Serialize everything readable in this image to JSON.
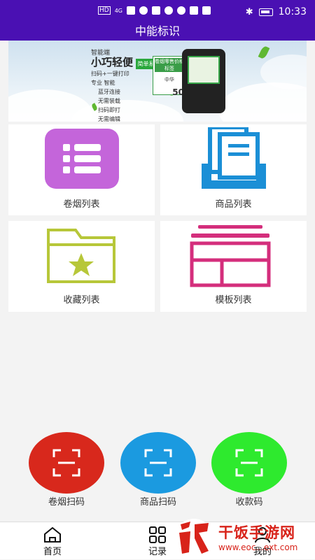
{
  "status_bar": {
    "time": "10:33",
    "network": "4G",
    "hd": "HD"
  },
  "app": {
    "title": "中能标识"
  },
  "banner": {
    "brand": "智能端",
    "slogan": "小巧轻便",
    "tag": "简单易用",
    "features": [
      "扫码+一键打印",
      "专业 智能",
      "蓝牙连接",
      "无需装载",
      "扫码即打",
      "无需编辑"
    ],
    "card_title": "卷烟零售价格标签",
    "card_name": "中华",
    "card_price": "50"
  },
  "tiles": [
    {
      "label": "卷烟列表",
      "icon": "list-icon",
      "color": "#c465da"
    },
    {
      "label": "商品列表",
      "icon": "document-tray-icon",
      "color": "#1b8fd6"
    },
    {
      "label": "收藏列表",
      "icon": "folder-star-icon",
      "color": "#b7c739"
    },
    {
      "label": "模板列表",
      "icon": "template-layout-icon",
      "color": "#d42e7c"
    }
  ],
  "scan_buttons": [
    {
      "label": "卷烟扫码",
      "color": "#d8281c"
    },
    {
      "label": "商品扫码",
      "color": "#1b9ae0"
    },
    {
      "label": "收款码",
      "color": "#2eea2e"
    }
  ],
  "tabbar": {
    "items": [
      {
        "label": "首页",
        "icon": "home-icon"
      },
      {
        "label": "记录",
        "icon": "grid-icon"
      },
      {
        "label": "我的",
        "icon": "person-icon"
      }
    ]
  },
  "watermark": {
    "name": "干饭手游网",
    "url": "www.eoc...ext.com"
  },
  "colors": {
    "header": "#4a10b3",
    "background": "#f3f3f3"
  }
}
